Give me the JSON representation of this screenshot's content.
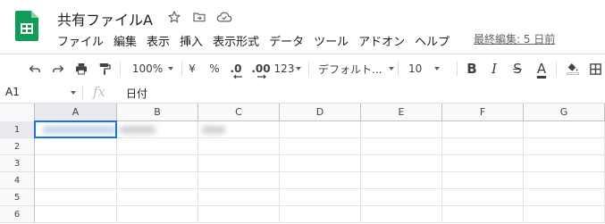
{
  "header": {
    "title": "共有ファイルA",
    "menu": [
      "ファイル",
      "編集",
      "表示",
      "挿入",
      "表示形式",
      "データ",
      "ツール",
      "アドオン",
      "ヘルプ"
    ],
    "last_edit": "最終編集: 5 日前",
    "icons": [
      "sheets-logo",
      "star-icon",
      "move-to-folder-icon",
      "cloud-status-icon"
    ]
  },
  "toolbar": {
    "zoom": "100%",
    "currency": "¥",
    "percent": "%",
    "decrease_decimal": ".0",
    "increase_decimal": ".00",
    "more_formats": "123",
    "font": "デフォルト...",
    "font_size": "10",
    "bold": "B",
    "italic": "I",
    "strikethrough": "S",
    "text_color": "A"
  },
  "formula_bar": {
    "name_box": "A1",
    "fx": "fx",
    "value": "日付"
  },
  "grid": {
    "columns": [
      "A",
      "B",
      "C",
      "D",
      "E",
      "F",
      "G"
    ],
    "rows": [
      "1",
      "2",
      "3",
      "4",
      "5",
      "6"
    ],
    "selected_cell": "A1"
  },
  "colors": {
    "sheets_green": "#0f9d58",
    "selection_blue": "#1a73e8"
  }
}
